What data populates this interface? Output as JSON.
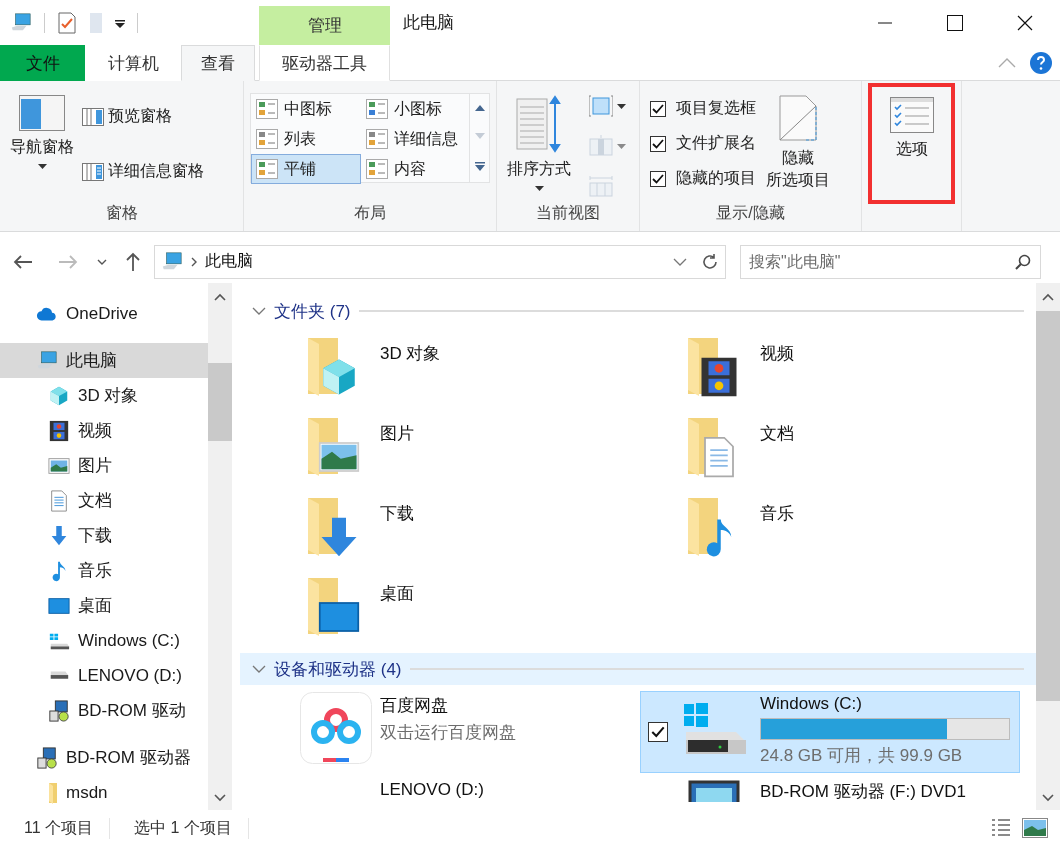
{
  "title": "此电脑",
  "context_tab_group": {
    "label": "管理"
  },
  "ribbon_tabs": [
    {
      "label": "文件",
      "kind": "file",
      "selected": false
    },
    {
      "label": "计算机",
      "kind": "tab",
      "selected": false
    },
    {
      "label": "查看",
      "kind": "tab",
      "selected": true
    },
    {
      "label": "驱动器工具",
      "kind": "context",
      "selected": false
    }
  ],
  "ribbon_groups": [
    {
      "kind": "panes",
      "label": "窗格",
      "items": [
        {
          "kind": "nav-pane",
          "label": "导航窗格",
          "dropdown": true
        },
        {
          "kind": "preview-pane",
          "label": "预览窗格"
        },
        {
          "kind": "details-pane",
          "label": "详细信息窗格"
        }
      ]
    },
    {
      "kind": "layout",
      "label": "布局",
      "items": [
        {
          "kind": "medium-icons",
          "label": "中图标",
          "selected": false
        },
        {
          "kind": "small-icons",
          "label": "小图标",
          "selected": false
        },
        {
          "kind": "list",
          "label": "列表",
          "selected": false
        },
        {
          "kind": "details",
          "label": "详细信息",
          "selected": false
        },
        {
          "kind": "tiles",
          "label": "平铺",
          "selected": true
        },
        {
          "kind": "content",
          "label": "内容",
          "selected": false
        }
      ]
    },
    {
      "kind": "current_view",
      "label": "当前视图",
      "items": [
        {
          "kind": "sort",
          "label": "排序方式",
          "dropdown": true
        },
        {
          "kind": "group-by",
          "dropdown": true,
          "disabled": false
        },
        {
          "kind": "add-columns",
          "dropdown": true,
          "disabled": true
        },
        {
          "kind": "fit-columns",
          "dropdown": false,
          "disabled": true
        }
      ]
    },
    {
      "kind": "show_hide",
      "label": "显示/隐藏",
      "items": [
        {
          "kind": "checkbox",
          "label": "项目复选框",
          "checked": true
        },
        {
          "kind": "checkbox",
          "label": "文件扩展名",
          "checked": true
        },
        {
          "kind": "checkbox",
          "label": "隐藏的项目",
          "checked": true
        },
        {
          "kind": "hide-selected",
          "lines": [
            "隐藏",
            "所选项目"
          ]
        }
      ]
    },
    {
      "kind": "options",
      "items": [
        {
          "kind": "options",
          "label": "选项",
          "highlighted": true
        }
      ]
    }
  ],
  "address": {
    "path": [
      "此电脑"
    ],
    "search_placeholder": "搜索\"此电脑\""
  },
  "sidebar": {
    "items": [
      {
        "label": "OneDrive",
        "kind": "cloud",
        "selected": false
      },
      {
        "label": "此电脑",
        "kind": "computer",
        "selected": true,
        "children": [
          {
            "label": "3D 对象",
            "kind": "cube",
            "selected": false
          },
          {
            "label": "视频",
            "kind": "film",
            "selected": false
          },
          {
            "label": "图片",
            "kind": "image",
            "selected": false
          },
          {
            "label": "文档",
            "kind": "doc",
            "selected": false
          },
          {
            "label": "下载",
            "kind": "download",
            "selected": false
          },
          {
            "label": "音乐",
            "kind": "music",
            "selected": false
          },
          {
            "label": "桌面",
            "kind": "desktop",
            "selected": false
          },
          {
            "label": "Windows (C:)",
            "kind": "windows-drive",
            "selected": false
          },
          {
            "label": "LENOVO (D:)",
            "kind": "drive",
            "selected": false
          },
          {
            "label": "BD-ROM 驱动",
            "kind": "optical",
            "selected": false
          }
        ]
      },
      {
        "label": "BD-ROM 驱动器",
        "kind": "optical",
        "selected": false,
        "children": [
          {
            "label": "msdn",
            "kind": "folder",
            "selected": false
          }
        ]
      }
    ]
  },
  "sections": [
    {
      "title": "文件夹 (7)",
      "expanded": true,
      "highlighted": false,
      "items": [
        {
          "kind": "cube-folder",
          "label": "3D 对象",
          "selected": false
        },
        {
          "kind": "film-folder",
          "label": "视频",
          "selected": false
        },
        {
          "kind": "image-folder",
          "label": "图片",
          "selected": false
        },
        {
          "kind": "doc-folder",
          "label": "文档",
          "selected": false
        },
        {
          "kind": "download-folder",
          "label": "下载",
          "selected": false
        },
        {
          "kind": "music-folder",
          "label": "音乐",
          "selected": false
        },
        {
          "kind": "desktop-folder",
          "label": "桌面",
          "selected": false
        }
      ]
    },
    {
      "title": "设备和驱动器 (4)",
      "expanded": true,
      "highlighted": true,
      "items": [
        {
          "kind": "app",
          "label": "百度网盘",
          "subtitle": "双击运行百度网盘",
          "selected": false
        },
        {
          "kind": "windows-drive",
          "label": "Windows (C:)",
          "subtitle": "24.8 GB 可用，共 99.9 GB",
          "level": 0.75,
          "selected": true,
          "checked": true
        },
        {
          "kind": "drive",
          "label": "LENOVO (D:)",
          "selected": false
        },
        {
          "kind": "optical",
          "label": "BD-ROM 驱动器 (F:) DVD1",
          "selected": false
        }
      ]
    }
  ],
  "status_bar": {
    "items": [
      "11 个项目",
      "选中 1 个项目"
    ]
  }
}
